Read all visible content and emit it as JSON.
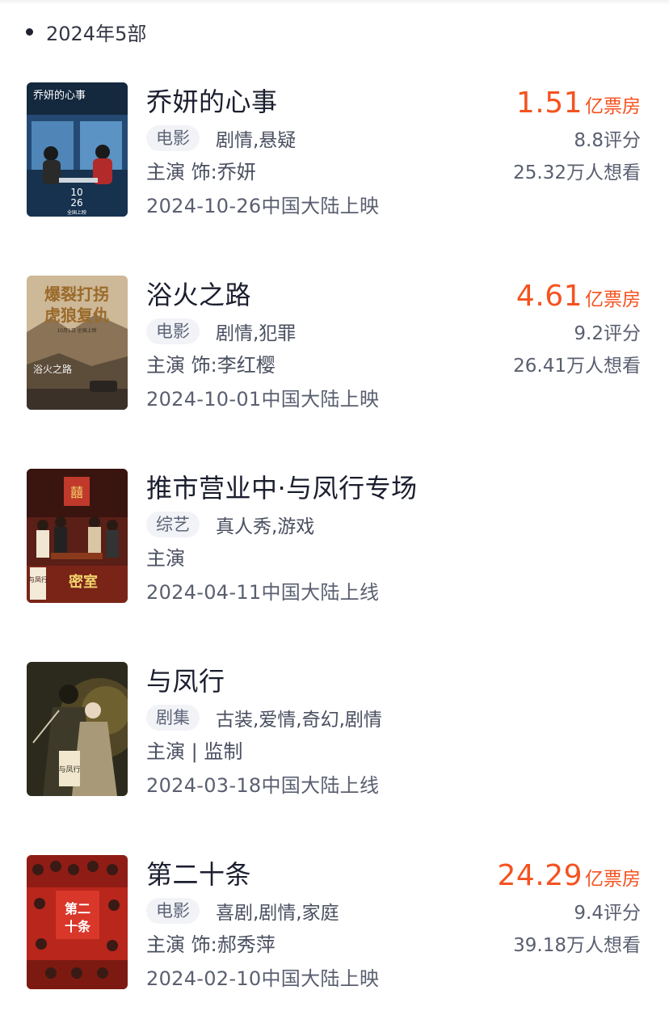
{
  "header": {
    "year_label": "2024年5部"
  },
  "works": [
    {
      "title": "乔妍的心事",
      "type": "电影",
      "genres": "剧情,悬疑",
      "role": "主演 饰:乔妍",
      "release": "2024-10-26中国大陆上映",
      "boxoffice": "1.51",
      "boxoffice_unit": "亿票房",
      "rating": "8.8评分",
      "wants": "25.32万人想看",
      "poster_icon": "movie-poster-qiaoyan",
      "poster_text": "乔妍的心事",
      "poster_date": "10\n26",
      "poster_sub": "全国上映"
    },
    {
      "title": "浴火之路",
      "type": "电影",
      "genres": "剧情,犯罪",
      "role": "主演 饰:李红樱",
      "release": "2024-10-01中国大陆上映",
      "boxoffice": "4.61",
      "boxoffice_unit": "亿票房",
      "rating": "9.2评分",
      "wants": "26.41万人想看",
      "poster_icon": "movie-poster-yuhuo",
      "poster_line1": "爆裂打拐",
      "poster_line2": "虎狼复仇",
      "poster_sub": "10月1日 全国上映",
      "poster_text": "浴火之路"
    },
    {
      "title": "推市营业中·与凤行专场",
      "type": "综艺",
      "genres": "真人秀,游戏",
      "role": "主演",
      "release": "2024-04-11中国大陆上线",
      "boxoffice": "",
      "boxoffice_unit": "",
      "rating": "",
      "wants": "",
      "poster_icon": "variety-poster-tuishi",
      "poster_text": "与凤行",
      "poster_sub": "密室"
    },
    {
      "title": "与凤行",
      "type": "剧集",
      "genres": "古装,爱情,奇幻,剧情",
      "role": "主演 | 监制",
      "release": "2024-03-18中国大陆上线",
      "boxoffice": "",
      "boxoffice_unit": "",
      "rating": "",
      "wants": "",
      "poster_icon": "series-poster-yufengxing",
      "poster_text": "与凤行"
    },
    {
      "title": "第二十条",
      "type": "电影",
      "genres": "喜剧,剧情,家庭",
      "role": "主演 饰:郝秀萍",
      "release": "2024-02-10中国大陆上映",
      "boxoffice": "24.29",
      "boxoffice_unit": "亿票房",
      "rating": "9.4评分",
      "wants": "39.18万人想看",
      "poster_icon": "movie-poster-dierhitiao",
      "poster_text": "第二十条"
    }
  ],
  "colors": {
    "accent": "#f5521f",
    "title": "#1b1e2e",
    "secondary": "#5a5f70",
    "tag_bg": "#f2f3f7"
  }
}
